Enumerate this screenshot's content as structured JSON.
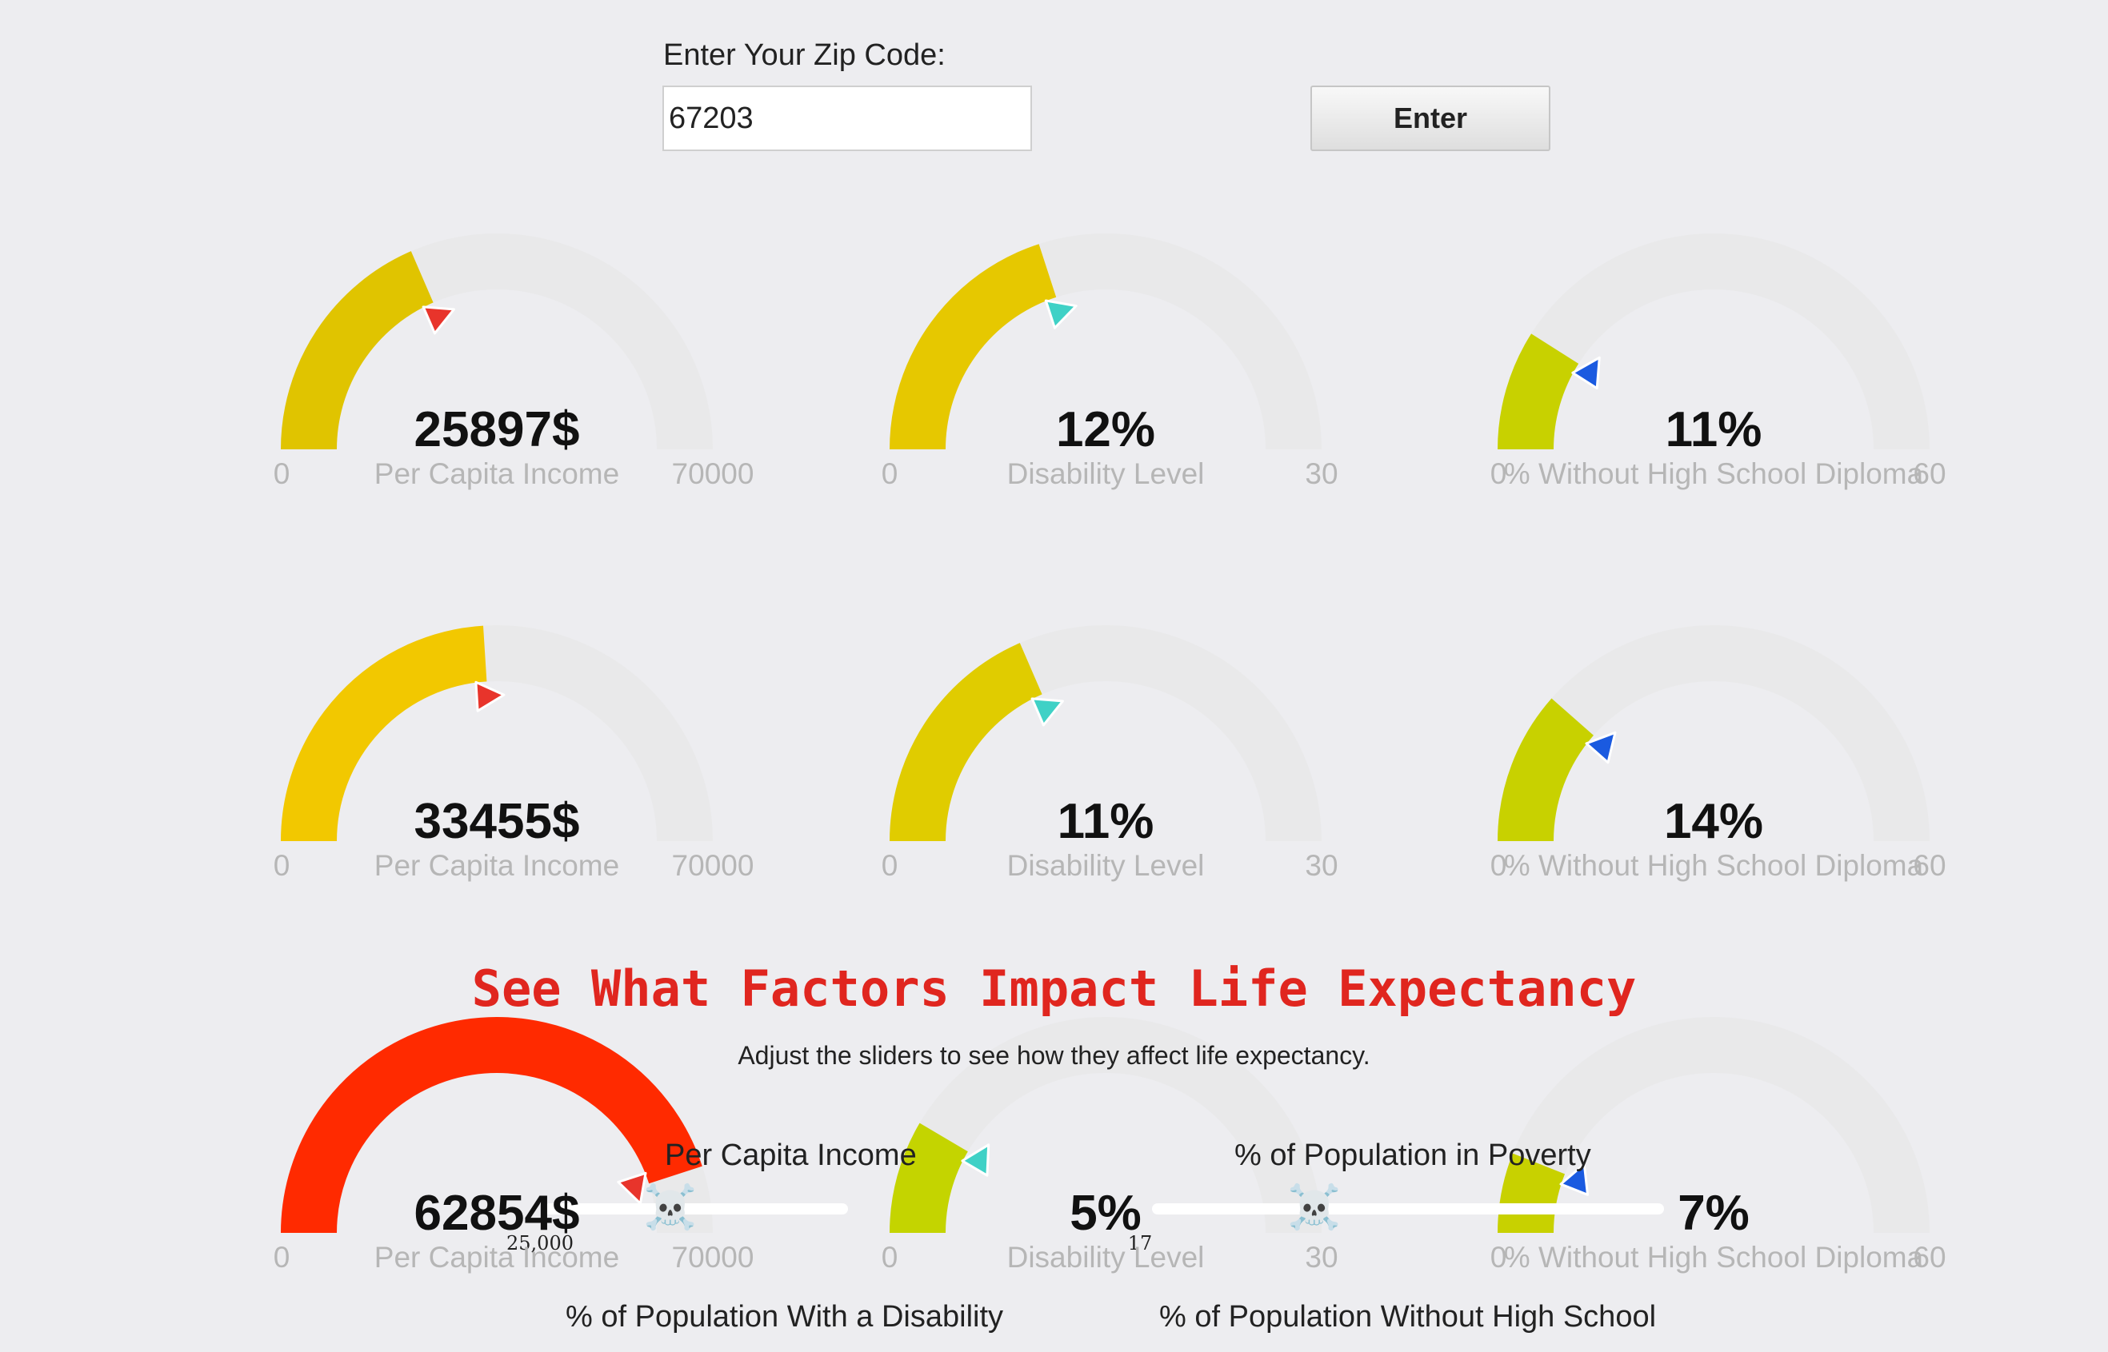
{
  "form": {
    "zip_label": "Enter Your Zip Code:",
    "zip_value": "67203",
    "enter_label": "Enter"
  },
  "gauges": [
    {
      "value": "25897$",
      "label": "Per Capita Income",
      "min": "0",
      "max": "70000",
      "fill": 0.37,
      "color": "#e0c400",
      "needle": "#e8342b"
    },
    {
      "value": "12%",
      "label": "Disability Level",
      "min": "0",
      "max": "30",
      "fill": 0.4,
      "color": "#e6c800",
      "needle": "#3fd1c6"
    },
    {
      "value": "11%",
      "label": "% Without High School Diploma",
      "min": "0",
      "max": "60",
      "fill": 0.18,
      "color": "#c8d100",
      "needle": "#1a5ae0"
    },
    {
      "value": "33455$",
      "label": "Per Capita Income",
      "min": "0",
      "max": "70000",
      "fill": 0.48,
      "color": "#f2c800",
      "needle": "#e8342b"
    },
    {
      "value": "11%",
      "label": "Disability Level",
      "min": "0",
      "max": "30",
      "fill": 0.37,
      "color": "#e0cc00",
      "needle": "#3fd1c6"
    },
    {
      "value": "14%",
      "label": "% Without High School Diploma",
      "min": "0",
      "max": "60",
      "fill": 0.23,
      "color": "#c8d100",
      "needle": "#1a5ae0"
    },
    {
      "value": "62854$",
      "label": "Per Capita Income",
      "min": "0",
      "max": "70000",
      "fill": 0.9,
      "color": "#ff2a00",
      "needle": "#e8342b"
    },
    {
      "value": "5%",
      "label": "Disability Level",
      "min": "0",
      "max": "30",
      "fill": 0.17,
      "color": "#c4d400",
      "needle": "#3fd1c6"
    },
    {
      "value": "7%",
      "label": "% Without High School Diploma",
      "min": "0",
      "max": "60",
      "fill": 0.12,
      "color": "#c8d100",
      "needle": "#1a5ae0"
    }
  ],
  "factors": {
    "title": "See What Factors Impact Life Expectancy",
    "subtitle": "Adjust the sliders to see how they affect life expectancy.",
    "sliders": [
      {
        "label": "Per Capita Income",
        "tick": "25,000"
      },
      {
        "label": "% of Population in Poverty",
        "tick": "17"
      },
      {
        "label": "% of Population With a Disability"
      },
      {
        "label": "% of Population Without High School"
      }
    ],
    "skull_glyph": "☠️"
  }
}
